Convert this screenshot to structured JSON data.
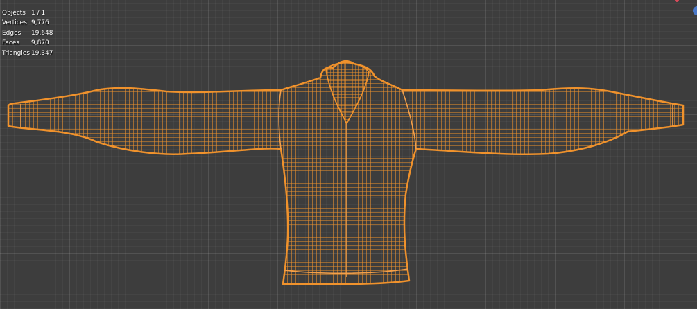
{
  "viewport": {
    "mesh_color": "#f0922c",
    "background_color": "#3d3d3d",
    "axis_color": "#4a72b8"
  },
  "stats": [
    {
      "label": "Objects",
      "value": "1 / 1"
    },
    {
      "label": "Vertices",
      "value": "9,776"
    },
    {
      "label": "Edges",
      "value": "19,648"
    },
    {
      "label": "Faces",
      "value": "9,870"
    },
    {
      "label": "Triangles",
      "value": "19,347"
    }
  ],
  "mesh": {
    "object": "shirt",
    "display_mode": "wireframe",
    "selected": true
  },
  "gizmo": {
    "z_axis_color": "#4a78c8",
    "x_axis_color": "#d84a5a"
  }
}
